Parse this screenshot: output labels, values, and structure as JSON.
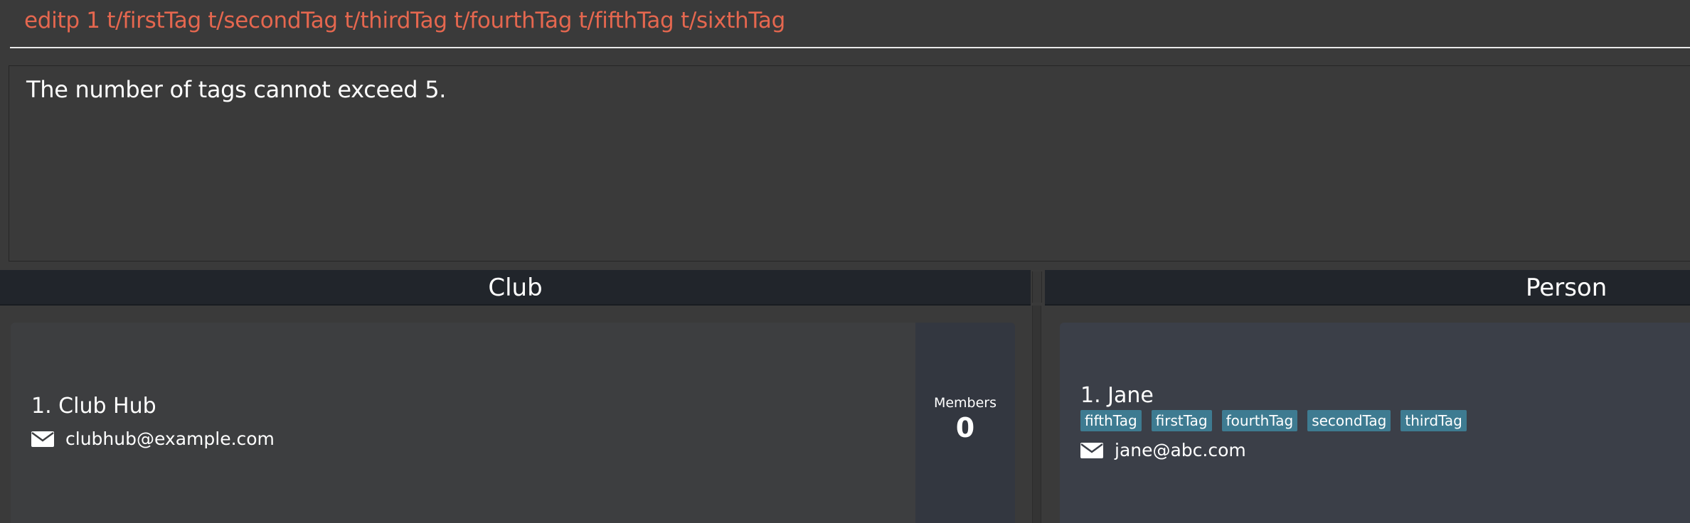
{
  "command_box": {
    "value": "editp 1 t/firstTag t/secondTag t/thirdTag t/fourthTag t/fifthTag t/sixthTag"
  },
  "result_display": {
    "text": "The number of tags cannot exceed 5."
  },
  "club_panel": {
    "header": "Club",
    "clubs": [
      {
        "index_name": "1. Club Hub",
        "email": "clubhub@example.com",
        "email_icon": "envelope-icon",
        "members_label": "Members",
        "members_count": "0"
      }
    ]
  },
  "person_panel": {
    "header": "Person",
    "persons": [
      {
        "index_name": "1. Jane",
        "tags": [
          "fifthTag",
          "firstTag",
          "fourthTag",
          "secondTag",
          "thirdTag"
        ],
        "email": "jane@abc.com",
        "email_icon": "envelope-icon"
      }
    ]
  },
  "colors": {
    "background": "#3a3a3a",
    "error_text": "#e5674f",
    "header_bg": "#21252b",
    "tag_bg": "#3e7b91",
    "person_card_bg": "#3b3f48",
    "club_card_bg": "#3d3e40",
    "members_bg": "#333740"
  }
}
